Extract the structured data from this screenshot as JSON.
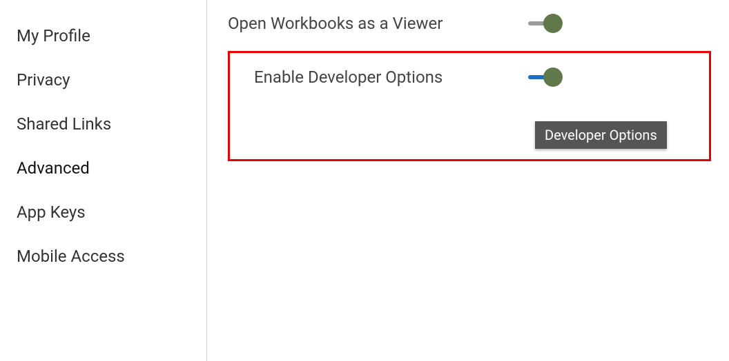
{
  "sidebar": {
    "items": [
      {
        "label": "My Profile"
      },
      {
        "label": "Privacy"
      },
      {
        "label": "Shared Links"
      },
      {
        "label": "Advanced"
      },
      {
        "label": "App Keys"
      },
      {
        "label": "Mobile Access"
      }
    ]
  },
  "settings": {
    "open_workbooks_label": "Open Workbooks as a Viewer",
    "enable_dev_label": "Enable Developer Options"
  },
  "tooltip": {
    "text": "Developer Options"
  }
}
